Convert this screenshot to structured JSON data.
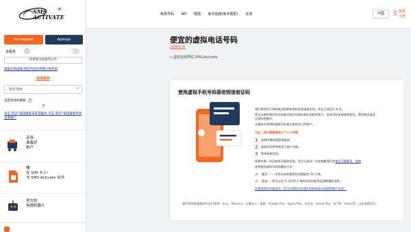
{
  "logo": {
    "line1": "SMS",
    "line2": "ACTIVATE"
  },
  "sidebar": {
    "activation_label": "Активация",
    "rent_label": "Аренда",
    "multi_label": "多服务",
    "multi_help": "?",
    "referral_text": "按需要注册推荐业务",
    "full_list_link": "按服务和国家/地区列出的完整价格列表",
    "service_title": "选择服务",
    "search_placeholder": "服务搜索",
    "favorites_label": "选定有效的数据",
    "favorites_help": "?",
    "favorites_count": "0",
    "not_found_link": "单击\"购买\"按钮搜索未获得服务 点击\"购买\"按钮搜索申请注册账户",
    "promo1_text": [
      "赤场",
      "准备好",
      "帐户"
    ],
    "promo2_text": [
      "赚",
      "在 SIM 卡上!",
      "与 SMS-Activate 合作"
    ],
    "promo3_text": [
      "官方的",
      "电报机器人"
    ]
  },
  "header": {
    "nav": [
      "免费号码",
      "API",
      "帮助",
      "新手指南(新手帮助)",
      "支持"
    ],
    "language": "中国",
    "login": "登录",
    "register": "注册"
  },
  "main": {
    "title": "便宜的虚拟电话号码",
    "subtitle": "日期和价格",
    "image_alt": "虚拟在线号码 SMS-Activate",
    "card": {
      "title": "使用虚拟手机号码接收短信验证码",
      "p1": "我们提供用于接收来自世界各地短信的虚拟号码，并且已经运行 8 年。",
      "p2": "您可以使用我们的号码来注册任何网站和应用程序账户。若该号码未接收到短信，费用将会退还",
      "p3": "至您的余额中。",
      "p4": "从服务中获得的虚拟号码来注册你自己的账户。",
      "steps_title": "为此，我们需要做到以下三个步骤：",
      "steps": [
        "选择所需的国家和服务。",
        "复制号码并将其用于账户注册。",
        "等待接收短信。"
      ],
      "p5": "如果在第一次没有成功接收短信，您可以再试一次或查看我们的",
      "p5_link": "常见问题解答、指南",
      "p6": "选择使用虚拟号码的最佳方法：",
      "p7": "激活 — 一次性号码的使用时间限制为 20 分钟。",
      "p8": "租金 — 您可以在 4 小时到 4 周的时间内收到无限数量的消息。",
      "p9": "在使用我们的服务时，您可以随时访问我们的帮助部分或获得客户支持。",
      "payments": "我们所有数量最多的支付系统：Visa、Maestro、万事达卡、银联、Google Pay、Apple Pay、支付宝、Kassa Pay、AirTM、Fawry等，以及加密货币。"
    }
  },
  "colors": {
    "accent": "#f26822",
    "navy": "#1e3a5c"
  }
}
